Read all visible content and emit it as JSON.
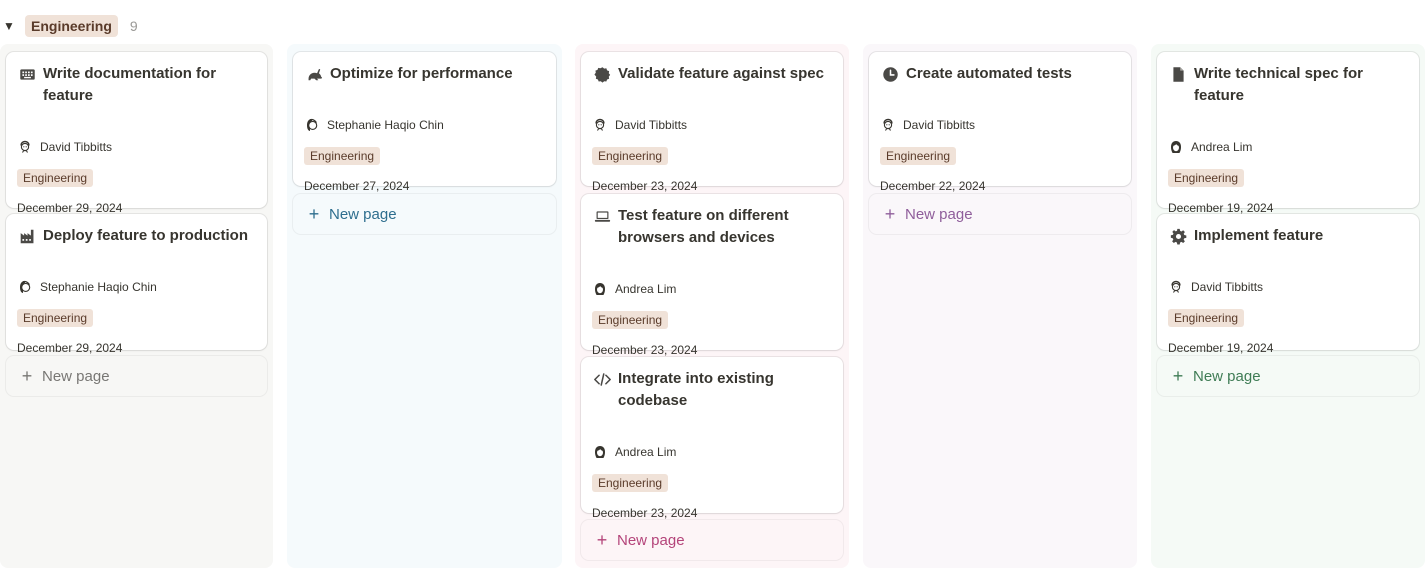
{
  "group": {
    "toggle": "▼",
    "label": "Engineering",
    "count": "9"
  },
  "new_page_label": "New page",
  "columns": [
    {
      "cards": [
        {
          "icon": "keyboard-icon",
          "title": "Write documentation for feature",
          "person": "David Tibbitts",
          "avatar": "david",
          "tag": "Engineering",
          "date": "December 29, 2024"
        },
        {
          "icon": "factory-icon",
          "title": "Deploy feature to production",
          "person": "Stephanie Haqio Chin",
          "avatar": "stephanie",
          "tag": "Engineering",
          "date": "December 29, 2024"
        }
      ],
      "bg": "#f7f7f5",
      "new_page_color": "#787774"
    },
    {
      "cards": [
        {
          "icon": "rabbit-icon",
          "title": "Optimize for performance",
          "person": "Stephanie Haqio Chin",
          "avatar": "stephanie",
          "tag": "Engineering",
          "date": "December 27, 2024"
        }
      ],
      "bg": "#f5fafc",
      "new_page_color": "#2e6e8e"
    },
    {
      "cards": [
        {
          "icon": "badge-icon",
          "title": "Validate feature against spec",
          "person": "David Tibbitts",
          "avatar": "david",
          "tag": "Engineering",
          "date": "December 23, 2024"
        },
        {
          "icon": "laptop-icon",
          "title": "Test feature on different browsers and devices",
          "person": "Andrea Lim",
          "avatar": "andrea",
          "tag": "Engineering",
          "date": "December 23, 2024"
        },
        {
          "icon": "code-icon",
          "title": "Integrate into existing codebase",
          "person": "Andrea Lim",
          "avatar": "andrea",
          "tag": "Engineering",
          "date": "December 23, 2024"
        }
      ],
      "bg": "#fdf5f7",
      "new_page_color": "#b4447a"
    },
    {
      "cards": [
        {
          "icon": "clock-icon",
          "title": "Create automated tests",
          "person": "David Tibbitts",
          "avatar": "david",
          "tag": "Engineering",
          "date": "December 22, 2024"
        }
      ],
      "bg": "#faf7fa",
      "new_page_color": "#8f5e9b"
    },
    {
      "cards": [
        {
          "icon": "document-icon",
          "title": "Write technical spec for feature",
          "person": "Andrea Lim",
          "avatar": "andrea",
          "tag": "Engineering",
          "date": "December 19, 2024"
        },
        {
          "icon": "gear-icon",
          "title": "Implement feature",
          "person": "David Tibbitts",
          "avatar": "david",
          "tag": "Engineering",
          "date": "December 19, 2024"
        }
      ],
      "bg": "#f5faf6",
      "new_page_color": "#3f7c55"
    }
  ]
}
